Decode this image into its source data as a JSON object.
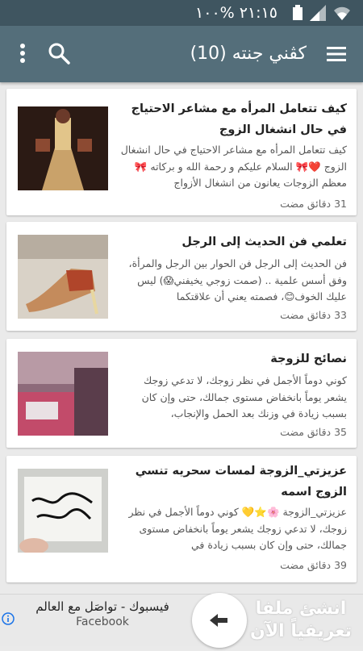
{
  "status_bar": {
    "time_battery": "٢١:١٥  %١٠٠"
  },
  "app_bar": {
    "title": "كڤني جنته (10)"
  },
  "posts": [
    {
      "title": "كيف تتعامل المرأه مع مشاعر الاحتياج في حال انشغال الزوج",
      "excerpt": "كيف تتعامل المرأه مع مشاعر الاحتياج في حال انشغال الزوج ❤️🎀 السلام عليكم و رحمة الله و بركاته 🎀 معظم الزوجات يعانون من انشغال الأزواج",
      "time": "31 دقائق مضت"
    },
    {
      "title": "تعلمي فن الحديث إلى الرجل",
      "excerpt": "فن الحديث إلى الرجل فن الحوار بين الرجل والمرأة، وفق أسس علمية .. (صمت زوجي يخيفني😱) ليس عليك الخوف😊، فصمته يعني أن علاقتكما",
      "time": "33 دقائق مضت"
    },
    {
      "title": "نصائح للزوجة",
      "excerpt": "كوني دوماً الأجمل في نظر زوجك، لا تدعي زوجك يشعر يوماً بانخفاض  مستوى جمالك، حتى وإن كان بسبب زيادة في وزنك بعد الحمل  والإنجاب،",
      "time": "35 دقائق مضت"
    },
    {
      "title": "عزيزتي_الزوجة لمسات سحريه تنسي الزوج اسمه",
      "excerpt": "عزيزتي_الزوجة 🌸⭐💛 كوني دوماً الأجمل في نظر زوجك، لا تدعي زوجك يشعر يوماً بانخفاض مستوى جمالك، حتى وإن كان بسبب زيادة في",
      "time": "39 دقائق مضت"
    }
  ],
  "ad": {
    "text": "فيسبوك - تواصَل مع العالم",
    "source": "Facebook",
    "headline": "انشئ ملفا تعريفياً الآن"
  }
}
